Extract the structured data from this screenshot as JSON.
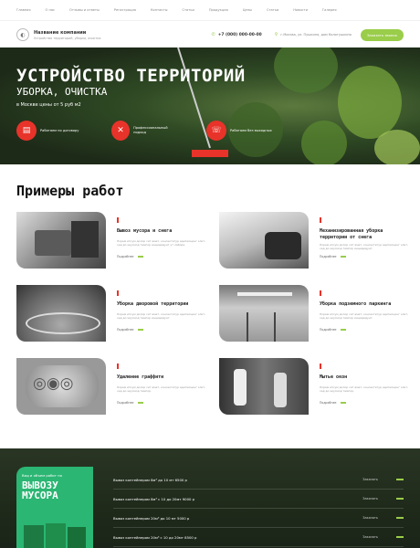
{
  "nav": [
    "Главная",
    "О нас",
    "Отзывы и ответы",
    "Регистрация",
    "Контакты",
    "Статьи",
    "Продукция",
    "Цены",
    "Статьи",
    "Новости",
    "Галерея"
  ],
  "header": {
    "company": "Название компании",
    "tagline": "Устройство территорий, уборка, очистка",
    "phone": "+7 (000) 000-00-00",
    "address": "г.Москва, ул. Пушкина, дом Колотушкина",
    "cta": "Заказать звонок"
  },
  "hero": {
    "title": "УСТРОЙСТВО ТЕРРИТОРИЙ",
    "subtitle": "УБОРКА, ОЧИСТКА",
    "price": "в Москве цены от 5 руб м2",
    "features": [
      {
        "label": "Работаем по договору",
        "icon": "document-icon"
      },
      {
        "label": "Профессиональный подход",
        "icon": "tools-icon"
      },
      {
        "label": "Работаем без выходных",
        "icon": "calendar-icon"
      }
    ]
  },
  "section_title": "Примеры работ",
  "works": [
    {
      "title": "Вывоз мусора и снега",
      "desc": "Лорем ипсум долор сит амет, консектетур адиписцинг элит, сед до эиусмод темпор инцидидунт ут лаборе.",
      "more": "Подробнее"
    },
    {
      "title": "Механизированная уборка территории от снега",
      "desc": "Лорем ипсум долор сит амет, консектетур адиписцинг элит, сед до эиусмод темпор инцидидунт.",
      "more": "Подробнее"
    },
    {
      "title": "Уборка дворовой территории",
      "desc": "Лорем ипсум долор сит амет, консектетур адиписцинг элит, сед до эиусмод темпор инцидидунт.",
      "more": "Подробнее"
    },
    {
      "title": "Уборка подземного паркинга",
      "desc": "Лорем ипсум долор сит амет, консектетур адиписцинг элит, сед до эиусмод темпор инцидидунт.",
      "more": "Подробнее"
    },
    {
      "title": "Удаление граффити",
      "desc": "Лорем ипсум долор сит амет, консектетур адиписцинг элит, сед до эиусмод темпор.",
      "more": "Подробнее"
    },
    {
      "title": "Мытье окон",
      "desc": "Лорем ипсум долор сит амет, консектетур адиписцинг элит, сед до эиусмод темпор.",
      "more": "Подробнее"
    }
  ],
  "promo": {
    "label": "Вид и объем работ по",
    "big": "ВЫВОЗУ МУСОРА"
  },
  "services": [
    {
      "text": "Вывоз контейнером 8м³ до 10 мт 6500 р",
      "link": "Заказать"
    },
    {
      "text": "Вывоз контейнером 8м³ с 10 до 20мт 9000 р",
      "link": "Заказать"
    },
    {
      "text": "Вывоз контейнером 20м³ до 10 мт 5000 р",
      "link": "Заказать"
    },
    {
      "text": "Вывоз контейнером 20м³ с 10 до 20мт 8500 р",
      "link": "Заказать"
    }
  ]
}
